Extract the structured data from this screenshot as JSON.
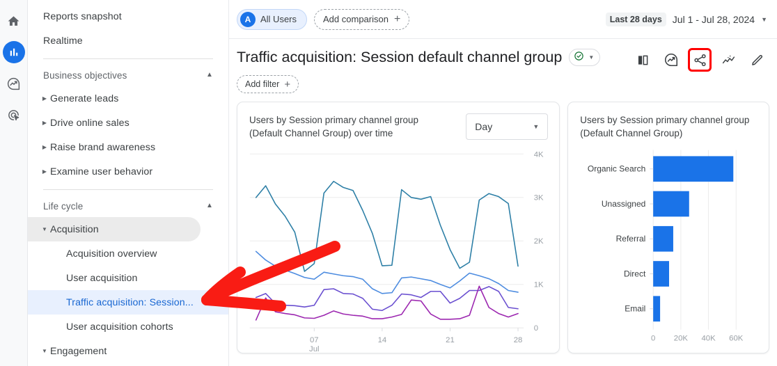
{
  "rail": {
    "items": [
      {
        "name": "home",
        "label": "Home",
        "active": false
      },
      {
        "name": "reports",
        "label": "Reports",
        "active": true
      },
      {
        "name": "explore",
        "label": "Explore",
        "active": false
      },
      {
        "name": "advertising",
        "label": "Advertising",
        "active": false
      }
    ]
  },
  "sidebar": {
    "top_items": [
      {
        "label": "Reports snapshot"
      },
      {
        "label": "Realtime"
      }
    ],
    "sections": [
      {
        "title": "Business objectives",
        "collapse_icon": "chevron-up-icon",
        "items": [
          {
            "label": "Generate leads"
          },
          {
            "label": "Drive online sales"
          },
          {
            "label": "Raise brand awareness"
          },
          {
            "label": "Examine user behavior"
          }
        ]
      },
      {
        "title": "Life cycle",
        "collapse_icon": "chevron-up-icon",
        "items": [
          {
            "label": "Acquisition",
            "expanded": true,
            "children": [
              {
                "label": "Acquisition overview",
                "selected": false
              },
              {
                "label": "User acquisition",
                "selected": false
              },
              {
                "label": "Traffic acquisition: Session...",
                "selected": true
              },
              {
                "label": "User acquisition cohorts",
                "selected": false
              }
            ]
          },
          {
            "label": "Engagement",
            "expanded": true,
            "children": []
          }
        ]
      }
    ]
  },
  "topbar": {
    "audience_chip": {
      "avatar": "A",
      "label": "All Users"
    },
    "add_comparison": {
      "label": "Add comparison",
      "icon": "plus-icon"
    },
    "date_badge": "Last 28 days",
    "date_range": "Jul 1 - Jul 28, 2024",
    "date_caret": "chevron-down-icon"
  },
  "header": {
    "title": "Traffic acquisition: Session default channel group",
    "badge_icon": "check-circle-icon",
    "badge_caret": "chevron-down-icon",
    "add_filter": {
      "label": "Add filter",
      "icon": "plus-icon"
    },
    "tools": [
      {
        "name": "compare-icon",
        "highlighted": false
      },
      {
        "name": "insights-icon",
        "highlighted": false
      },
      {
        "name": "share-icon",
        "highlighted": true
      },
      {
        "name": "trend-chart-icon",
        "highlighted": false
      },
      {
        "name": "edit-pencil-icon",
        "highlighted": false
      }
    ]
  },
  "line_card": {
    "title": "Users by Session primary channel group (Default Channel Group) over time",
    "granularity": "Day",
    "granularity_caret": "chevron-down-icon"
  },
  "bar_card": {
    "title": "Users by Session primary channel group (Default Channel Group)"
  },
  "annotation": {
    "type": "red-arrow",
    "color": "#f91c14",
    "points_to": "Traffic acquisition: Session..."
  },
  "chart_data": [
    {
      "type": "line",
      "title": "Users by Session primary channel group (Default Channel Group) over time",
      "xlabel": "",
      "ylabel": "",
      "ylim": [
        0,
        4000
      ],
      "yticks": [
        0,
        1000,
        2000,
        3000,
        4000
      ],
      "ytick_labels": [
        "0",
        "1K",
        "2K",
        "3K",
        "4K"
      ],
      "xticks": [
        7,
        14,
        21,
        28
      ],
      "xtick_labels": [
        "07",
        "14",
        "21",
        "28"
      ],
      "xtick_sublabel": "Jul",
      "grid": true,
      "x": [
        1,
        2,
        3,
        4,
        5,
        6,
        7,
        8,
        9,
        10,
        11,
        12,
        13,
        14,
        15,
        16,
        17,
        18,
        19,
        20,
        21,
        22,
        23,
        24,
        25,
        26,
        27,
        28
      ],
      "series": [
        {
          "name": "Organic Search",
          "color": "#2d7fa6",
          "values": [
            3000,
            3270,
            2850,
            2570,
            2200,
            1300,
            1480,
            3100,
            3370,
            3230,
            3160,
            2700,
            2170,
            1430,
            1440,
            3180,
            3000,
            2960,
            3020,
            2360,
            1800,
            1370,
            1510,
            2940,
            3090,
            3020,
            2860,
            1420
          ]
        },
        {
          "name": "Unassigned",
          "color": "#4d8ce0",
          "values": [
            1760,
            1560,
            1420,
            1330,
            1250,
            1160,
            1120,
            1280,
            1240,
            1200,
            1180,
            1120,
            900,
            790,
            810,
            1150,
            1170,
            1130,
            1090,
            1000,
            920,
            1080,
            1260,
            1200,
            1130,
            1020,
            860,
            820
          ]
        },
        {
          "name": "Referral",
          "color": "#6a4fd0",
          "values": [
            700,
            790,
            560,
            520,
            510,
            480,
            520,
            880,
            900,
            790,
            780,
            680,
            430,
            400,
            520,
            780,
            760,
            700,
            840,
            840,
            570,
            680,
            860,
            860,
            950,
            840,
            470,
            440
          ]
        },
        {
          "name": "Direct",
          "color": "#9c27b0",
          "values": [
            180,
            690,
            370,
            330,
            300,
            230,
            220,
            290,
            390,
            320,
            290,
            270,
            210,
            210,
            250,
            310,
            640,
            620,
            320,
            200,
            200,
            210,
            290,
            960,
            470,
            330,
            250,
            330
          ]
        }
      ]
    },
    {
      "type": "bar",
      "orientation": "horizontal",
      "title": "Users by Session primary channel group (Default Channel Group)",
      "categories": [
        "Organic Search",
        "Unassigned",
        "Referral",
        "Direct",
        "Email"
      ],
      "values": [
        58000,
        26000,
        14500,
        11500,
        5000
      ],
      "color": "#1a73e8",
      "xlim": [
        0,
        70000
      ],
      "xticks": [
        0,
        20000,
        40000,
        60000
      ],
      "xtick_labels": [
        "0",
        "20K",
        "40K",
        "60K"
      ],
      "ylabel": "",
      "xlabel": "",
      "grid": true
    }
  ]
}
